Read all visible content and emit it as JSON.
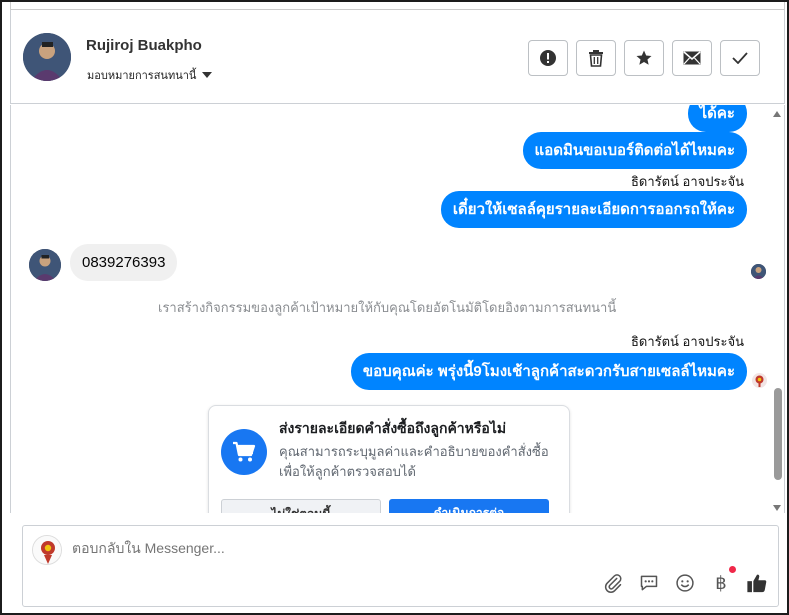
{
  "header": {
    "name": "Rujiroj Buakpho",
    "assign_label": "มอบหมายการสนทนานี้",
    "actions": [
      "alert",
      "delete",
      "star",
      "mail",
      "done"
    ]
  },
  "messages": {
    "out1": "ได้คะ",
    "out2": "แอดมินขอเบอร์ติดต่อได้ไหมคะ",
    "sender1": "ธิดารัตน์ อาจประจัน",
    "out3": "เดี๋ยวให้เซลล์คุยรายละเอียดการออกรถให้คะ",
    "in1": "0839276393",
    "system": "เราสร้างกิจกรรมของลูกค้าเป้าหมายให้กับคุณโดยอัตโนมัติโดยอิงตามการสนทนานี้",
    "sender2": "ธิดารัตน์ อาจประจัน",
    "out4": "ขอบคุณค่ะ พรุ่งนี้9โมงเช้าลูกค้าสะดวกรับสายเซลล์ไหมคะ"
  },
  "card": {
    "title": "ส่งรายละเอียดคำสั่งซื้อถึงลูกค้าหรือไม่",
    "desc": "คุณสามารถระบุมูลค่าและคำอธิบายของคำสั่งซื้อเพื่อให้ลูกค้าตรวจสอบได้",
    "btn_secondary": "ไม่ใช่ตอนนี้",
    "btn_primary": "ดำเนินการต่อ"
  },
  "composer": {
    "placeholder": "ตอบกลับใน Messenger...",
    "currency_symbol": "฿"
  },
  "colors": {
    "accent": "#0084ff",
    "brand": "#1877f2",
    "notification": "#f02849"
  }
}
